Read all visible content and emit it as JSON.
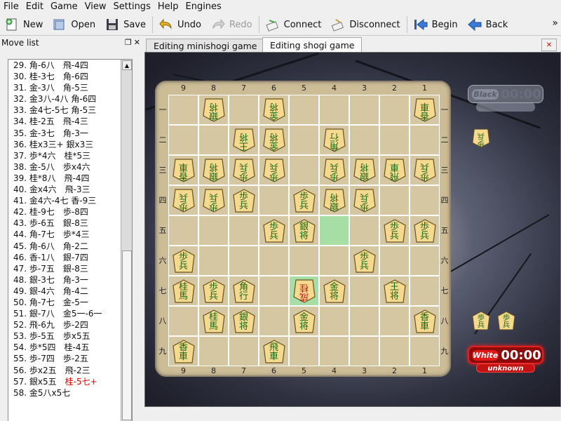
{
  "menu": [
    "File",
    "Edit",
    "Game",
    "View",
    "Settings",
    "Help",
    "Engines"
  ],
  "toolbar": {
    "new": "New",
    "open": "Open",
    "save": "Save",
    "undo": "Undo",
    "redo": "Redo",
    "connect": "Connect",
    "disconnect": "Disconnect",
    "begin": "Begin",
    "back": "Back",
    "more": "»"
  },
  "dock": {
    "title": "Move list"
  },
  "moves": [
    "29. 角-6八　飛-4四",
    "30. 桂-3七　角-6四",
    "31. 金-3八　角-5三",
    "32. 金3八-4八 角-6四",
    "33. 金4七-5七 角-5三",
    "34. 桂-2五　飛-4三",
    "35. 金-3七　角-3一",
    "36. 桂x3三+ 銀x3三",
    "37. 歩*4六　桂*5三",
    "38. 金-5八　歩x4六",
    "39. 桂*8八　飛-4四",
    "40. 金x4六　飛-3三",
    "41. 金4六-4七 香-9三",
    "42. 桂-9七　歩-8四",
    "43. 歩-6五　銀-8三",
    "44. 角-7七　歩*4三",
    "45. 角-6八　角-2二",
    "46. 香-1八　銀-7四",
    "47. 歩-7五　銀-8三",
    "48. 銀-3七　角-3一",
    "49. 銀-4六　角-4二",
    "50. 角-7七　金-5一",
    "51. 銀-7八　金5一-6一",
    "52. 飛-6九　歩-2四",
    "53. 歩-5五　歩x5五",
    "54. 歩*5四　桂-4五",
    "55. 歩-7四　歩-2五",
    "56. 歩x2五　飛-2三",
    "57. 銀x5五　",
    "58. 金5八x5七"
  ],
  "current_move": "桂-5七+",
  "tabs": {
    "minishogi": "Editing minishogi game",
    "shogi": "Editing shogi game"
  },
  "board": {
    "files": [
      "9",
      "8",
      "7",
      "6",
      "5",
      "4",
      "3",
      "2",
      "1"
    ],
    "ranks": [
      "一",
      "二",
      "三",
      "四",
      "五",
      "六",
      "七",
      "八",
      "九"
    ]
  },
  "pieces": [
    {
      "f": 8,
      "r": 1,
      "c1": "銀",
      "c2": "将",
      "side": "gote",
      "promo": false
    },
    {
      "f": 6,
      "r": 1,
      "c1": "金",
      "c2": "将",
      "side": "gote",
      "promo": false
    },
    {
      "f": 1,
      "r": 1,
      "c1": "香",
      "c2": "車",
      "side": "gote",
      "promo": false
    },
    {
      "f": 7,
      "r": 2,
      "c1": "王",
      "c2": "将",
      "side": "gote",
      "promo": false
    },
    {
      "f": 6,
      "r": 2,
      "c1": "金",
      "c2": "将",
      "side": "gote",
      "promo": false
    },
    {
      "f": 4,
      "r": 2,
      "c1": "角",
      "c2": "行",
      "side": "gote",
      "promo": false
    },
    {
      "f": 9,
      "r": 3,
      "c1": "香",
      "c2": "車",
      "side": "gote",
      "promo": false
    },
    {
      "f": 8,
      "r": 3,
      "c1": "銀",
      "c2": "将",
      "side": "gote",
      "promo": false
    },
    {
      "f": 7,
      "r": 3,
      "c1": "歩",
      "c2": "兵",
      "side": "gote",
      "promo": false
    },
    {
      "f": 6,
      "r": 3,
      "c1": "歩",
      "c2": "兵",
      "side": "gote",
      "promo": false
    },
    {
      "f": 4,
      "r": 3,
      "c1": "歩",
      "c2": "兵",
      "side": "gote",
      "promo": false
    },
    {
      "f": 3,
      "r": 3,
      "c1": "銀",
      "c2": "将",
      "side": "gote",
      "promo": false
    },
    {
      "f": 2,
      "r": 3,
      "c1": "飛",
      "c2": "車",
      "side": "gote",
      "promo": false
    },
    {
      "f": 1,
      "r": 3,
      "c1": "歩",
      "c2": "兵",
      "side": "gote",
      "promo": false
    },
    {
      "f": 9,
      "r": 4,
      "c1": "歩",
      "c2": "兵",
      "side": "gote",
      "promo": false
    },
    {
      "f": 8,
      "r": 4,
      "c1": "歩",
      "c2": "兵",
      "side": "gote",
      "promo": false
    },
    {
      "f": 7,
      "r": 4,
      "c1": "歩",
      "c2": "兵",
      "side": "sente",
      "promo": false
    },
    {
      "f": 5,
      "r": 4,
      "c1": "歩",
      "c2": "兵",
      "side": "sente",
      "promo": false
    },
    {
      "f": 4,
      "r": 4,
      "c1": "銀",
      "c2": "将",
      "side": "gote",
      "promo": false
    },
    {
      "f": 3,
      "r": 4,
      "c1": "歩",
      "c2": "兵",
      "side": "gote",
      "promo": false
    },
    {
      "f": 6,
      "r": 5,
      "c1": "歩",
      "c2": "兵",
      "side": "sente",
      "promo": false
    },
    {
      "f": 5,
      "r": 5,
      "c1": "銀",
      "c2": "将",
      "side": "sente",
      "promo": false
    },
    {
      "f": 2,
      "r": 5,
      "c1": "歩",
      "c2": "兵",
      "side": "sente",
      "promo": false
    },
    {
      "f": 1,
      "r": 5,
      "c1": "歩",
      "c2": "兵",
      "side": "sente",
      "promo": false
    },
    {
      "f": 9,
      "r": 6,
      "c1": "歩",
      "c2": "兵",
      "side": "sente",
      "promo": false
    },
    {
      "f": 3,
      "r": 6,
      "c1": "歩",
      "c2": "兵",
      "side": "sente",
      "promo": false
    },
    {
      "f": 9,
      "r": 7,
      "c1": "桂",
      "c2": "馬",
      "side": "sente",
      "promo": false
    },
    {
      "f": 8,
      "r": 7,
      "c1": "歩",
      "c2": "兵",
      "side": "sente",
      "promo": false
    },
    {
      "f": 7,
      "r": 7,
      "c1": "角",
      "c2": "行",
      "side": "sente",
      "promo": false
    },
    {
      "f": 5,
      "r": 7,
      "c1": "成",
      "c2": "桂",
      "side": "gote",
      "promo": true
    },
    {
      "f": 4,
      "r": 7,
      "c1": "金",
      "c2": "将",
      "side": "sente",
      "promo": false
    },
    {
      "f": 2,
      "r": 7,
      "c1": "王",
      "c2": "将",
      "side": "sente",
      "promo": false
    },
    {
      "f": 8,
      "r": 8,
      "c1": "桂",
      "c2": "馬",
      "side": "sente",
      "promo": false
    },
    {
      "f": 7,
      "r": 8,
      "c1": "銀",
      "c2": "将",
      "side": "sente",
      "promo": false
    },
    {
      "f": 5,
      "r": 8,
      "c1": "金",
      "c2": "将",
      "side": "sente",
      "promo": false
    },
    {
      "f": 1,
      "r": 8,
      "c1": "香",
      "c2": "車",
      "side": "sente",
      "promo": false
    },
    {
      "f": 9,
      "r": 9,
      "c1": "香",
      "c2": "車",
      "side": "sente",
      "promo": false
    },
    {
      "f": 6,
      "r": 9,
      "c1": "飛",
      "c2": "車",
      "side": "sente",
      "promo": false
    }
  ],
  "highlights": [
    [
      4,
      5
    ],
    [
      5,
      7
    ]
  ],
  "hands": {
    "black": [
      {
        "c1": "歩",
        "c2": "兵"
      }
    ],
    "white": [
      {
        "c1": "歩",
        "c2": "兵"
      },
      {
        "c1": "歩",
        "c2": "兵"
      }
    ]
  },
  "clocks": {
    "black": {
      "name": "Black",
      "time": "00:00",
      "player": "unknown"
    },
    "white": {
      "name": "White",
      "time": "00:00",
      "player": "unknown"
    }
  },
  "colors": {
    "piece_text": "#1a6a1a",
    "promoted_text": "#c21818",
    "highlight": "#a7dea5",
    "active_clock": "#e01818"
  }
}
